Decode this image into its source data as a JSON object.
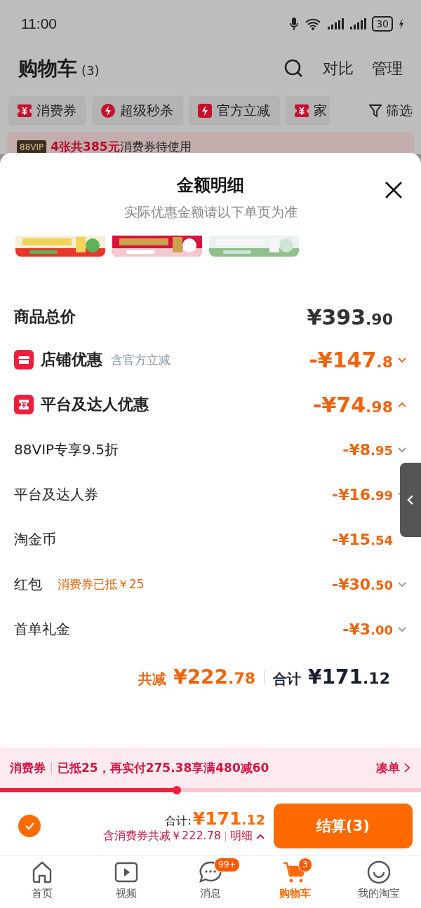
{
  "status_bar": {
    "time": "11:00",
    "battery": "30"
  },
  "page": {
    "title": "购物车",
    "count": "(3)",
    "actions": [
      "对比",
      "管理"
    ],
    "filters": [
      {
        "label": "消费券"
      },
      {
        "label": "超级秒杀"
      },
      {
        "label": "官方立减"
      },
      {
        "label": "家"
      }
    ],
    "filter_button": "筛选",
    "notice": {
      "badge": "88VIP",
      "highlight": "4张共385元",
      "text": "消费券待使用"
    }
  },
  "sheet": {
    "title": "金额明细",
    "subtitle": "实际优惠金额请以下单页为准",
    "rows": [
      {
        "kind": "total",
        "label": "商品总价",
        "amount": "¥393.90"
      },
      {
        "kind": "group",
        "label": "店铺优惠",
        "note": "含官方立减",
        "amount": "-¥147.8",
        "expanded": false
      },
      {
        "kind": "group",
        "label": "平台及达人优惠",
        "amount": "-¥74.98",
        "expanded": true
      },
      {
        "kind": "item",
        "label": "88VIP专享9.5折",
        "amount": "-¥8.95",
        "expanded": false
      },
      {
        "kind": "item",
        "label": "平台及达人券",
        "amount": "-¥16.99",
        "expanded": false
      },
      {
        "kind": "plain",
        "label": "淘金币",
        "amount": "-¥15.54"
      },
      {
        "kind": "item",
        "label": "红包",
        "note": "消费券已抵￥25",
        "amount": "-¥30.50",
        "expanded": false
      },
      {
        "kind": "item",
        "label": "首单礼金",
        "amount": "-¥3.00",
        "expanded": false
      }
    ],
    "summary": {
      "saved_label": "共减",
      "saved": "¥222.78",
      "total_label": "合计",
      "total": "¥171.12"
    }
  },
  "coupon_bar": {
    "tag": "消费券",
    "text": "已抵25，再实付275.38享满480减60",
    "link": "凑单",
    "level": 0.42
  },
  "checkout": {
    "select_all": {
      "checked": true
    },
    "total_label": "合计:",
    "total": "¥171.12",
    "saved": "含消费券共减￥222.78",
    "detail": "明细",
    "detail_expanded": true,
    "button": "结算(3)"
  },
  "tab_bar": [
    {
      "label": "首页",
      "selected": false
    },
    {
      "label": "视频",
      "selected": false
    },
    {
      "label": "消息",
      "badge": "99+",
      "selected": false
    },
    {
      "label": "购物车",
      "badge": "3",
      "selected": true
    },
    {
      "label": "我的淘宝",
      "selected": false
    }
  ]
}
